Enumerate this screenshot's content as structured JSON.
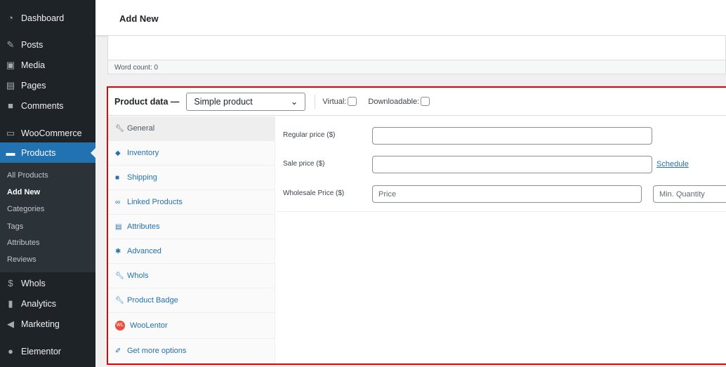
{
  "sidebar": {
    "items": [
      {
        "label": "Dashboard",
        "icon": "dashboard-icon"
      },
      {
        "label": "Posts",
        "icon": "pin-icon"
      },
      {
        "label": "Media",
        "icon": "media-icon"
      },
      {
        "label": "Pages",
        "icon": "pages-icon"
      },
      {
        "label": "Comments",
        "icon": "comment-icon"
      },
      {
        "label": "WooCommerce",
        "icon": "woo-icon"
      },
      {
        "label": "Products",
        "icon": "archive-icon"
      },
      {
        "label": "Whols",
        "icon": "dollar-icon"
      },
      {
        "label": "Analytics",
        "icon": "bar-chart-icon"
      },
      {
        "label": "Marketing",
        "icon": "megaphone-icon"
      },
      {
        "label": "Elementor",
        "icon": "elementor-icon"
      }
    ],
    "submenu": [
      "All Products",
      "Add New",
      "Categories",
      "Tags",
      "Attributes",
      "Reviews"
    ]
  },
  "header": {
    "title": "Add New"
  },
  "editor": {
    "word_count": "Word count: 0"
  },
  "product_data": {
    "label": "Product data —",
    "type": "Simple product",
    "virtual": "Virtual:",
    "downloadable": "Downloadable:",
    "tabs": [
      "General",
      "Inventory",
      "Shipping",
      "Linked Products",
      "Attributes",
      "Advanced",
      "Whols",
      "Product Badge",
      "WooLentor",
      "Get more options"
    ],
    "regular_price_label": "Regular price ($)",
    "sale_price_label": "Sale price ($)",
    "schedule": "Schedule",
    "wholesale_label": "Wholesale Price ($)",
    "price_placeholder": "Price",
    "min_qty_placeholder": "Min. Quantity"
  },
  "colors": {
    "accent": "#2271b1",
    "highlight_border": "#e00000"
  }
}
